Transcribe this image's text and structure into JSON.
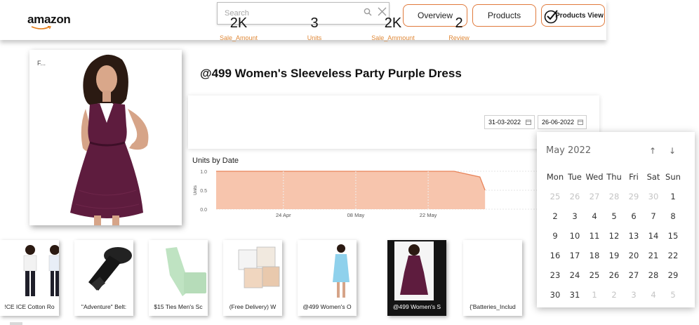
{
  "header": {
    "logo_text": "amazon",
    "search_placeholder": "Search",
    "nav": {
      "overview": "Overview",
      "products": "Products",
      "products_view": "Products View"
    }
  },
  "product": {
    "card_label": "F...",
    "title": "@499 Women's Sleeveless Party Purple Dress"
  },
  "kpis": [
    {
      "value": "2K",
      "label": "Sale_Amount"
    },
    {
      "value": "3",
      "label": "Units"
    },
    {
      "value": "2K",
      "label": "Sale_Ammount"
    },
    {
      "value": "2",
      "label": "Review"
    }
  ],
  "date_range": {
    "start": "31-03-2022",
    "end": "26-06-2022"
  },
  "chart_data": {
    "type": "area",
    "title": "Units by Date",
    "xlabel": "",
    "ylabel": "Units",
    "yticks": [
      "1.0",
      "0.5",
      "0.0"
    ],
    "ylim": [
      0,
      1
    ],
    "x_tick_labels": [
      "24 Apr",
      "08 May",
      "22 May"
    ],
    "x": [
      "2022-04-11",
      "2022-04-24",
      "2022-05-08",
      "2022-05-22",
      "2022-05-27",
      "2022-06-01",
      "2022-06-02"
    ],
    "values": [
      1.0,
      1.0,
      1.0,
      1.0,
      1.0,
      0.85,
      0.5
    ],
    "color": "#f7c5ad",
    "line_color": "#e8845a",
    "grid": true
  },
  "thumbnails": [
    {
      "label": "!CE ICE Cotton Ro",
      "icon": "kids-tshirt-image",
      "selected": false
    },
    {
      "label": "\"Adventure\" Belt:",
      "icon": "black-belt-image",
      "selected": false
    },
    {
      "label": "$15 Ties Men's Sc",
      "icon": "green-tie-image",
      "selected": false
    },
    {
      "label": "(Free Delivery) W",
      "icon": "bra-extender-image",
      "selected": false
    },
    {
      "label": "@499 Women's O",
      "icon": "blue-dress-image",
      "selected": false
    },
    {
      "label": "@499 Women's S",
      "icon": "purple-dress-image",
      "selected": true
    },
    {
      "label": "{'Batteries_Includ",
      "icon": "blank-image",
      "selected": false
    }
  ],
  "calendar": {
    "month_label": "May 2022",
    "weekdays": [
      "Mon",
      "Tue",
      "Wed",
      "Thu",
      "Fri",
      "Sat",
      "Sun"
    ],
    "weeks": [
      [
        "25",
        "26",
        "27",
        "28",
        "29",
        "30",
        "1"
      ],
      [
        "2",
        "3",
        "4",
        "5",
        "6",
        "7",
        "8"
      ],
      [
        "9",
        "10",
        "11",
        "12",
        "13",
        "14",
        "15"
      ],
      [
        "16",
        "17",
        "18",
        "19",
        "20",
        "21",
        "22"
      ],
      [
        "23",
        "24",
        "25",
        "26",
        "27",
        "28",
        "29"
      ],
      [
        "30",
        "31",
        "1",
        "2",
        "3",
        "4",
        "5"
      ]
    ],
    "muted": [
      [
        true,
        true,
        true,
        true,
        true,
        true,
        false
      ],
      [
        false,
        false,
        false,
        false,
        false,
        false,
        false
      ],
      [
        false,
        false,
        false,
        false,
        false,
        false,
        false
      ],
      [
        false,
        false,
        false,
        false,
        false,
        false,
        false
      ],
      [
        false,
        false,
        false,
        false,
        false,
        false,
        false
      ],
      [
        false,
        false,
        true,
        true,
        true,
        true,
        true
      ]
    ]
  },
  "colors": {
    "accent": "#e07a3c",
    "kpi_label": "#e08a3a",
    "area_fill": "#f7c5ad",
    "area_line": "#e8845a"
  }
}
